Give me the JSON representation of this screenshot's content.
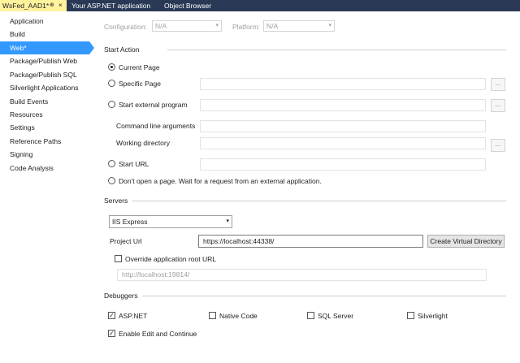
{
  "tabs": {
    "active": "WsFed_AAD1*",
    "pin_glyph": "⊕",
    "close_glyph": "×",
    "others": [
      "Your ASP.NET application",
      "Object Browser"
    ]
  },
  "sidebar": {
    "items": [
      {
        "label": "Application"
      },
      {
        "label": "Build"
      },
      {
        "label": "Web*"
      },
      {
        "label": "Package/Publish Web"
      },
      {
        "label": "Package/Publish SQL"
      },
      {
        "label": "Silverlight Applications"
      },
      {
        "label": "Build Events"
      },
      {
        "label": "Resources"
      },
      {
        "label": "Settings"
      },
      {
        "label": "Reference Paths"
      },
      {
        "label": "Signing"
      },
      {
        "label": "Code Analysis"
      }
    ],
    "selected_index": 2
  },
  "config": {
    "configuration_label": "Configuration:",
    "configuration_value": "N/A",
    "platform_label": "Platform:",
    "platform_value": "N/A"
  },
  "start_action": {
    "title": "Start Action",
    "current_page": "Current Page",
    "specific_page": "Specific Page",
    "external_program": "Start external program",
    "command_line_args": "Command line arguments",
    "working_directory": "Working directory",
    "start_url": "Start URL",
    "dont_open": "Don't open a page.  Wait for a request from an external application.",
    "browse_label": "..."
  },
  "servers": {
    "title": "Servers",
    "server_value": "IIS Express",
    "project_url_label": "Project Url",
    "project_url_value": "https://localhost:44338/",
    "create_vdir_button": "Create Virtual Directory",
    "override_label": "Override application root URL",
    "override_value": "http://localhost:19814/"
  },
  "debuggers": {
    "title": "Debuggers",
    "aspnet": "ASP.NET",
    "native": "Native Code",
    "sql": "SQL Server",
    "silverlight": "Silverlight",
    "edit_continue": "Enable Edit and Continue"
  },
  "glyphs": {
    "check": "✓",
    "dropdown": "▾"
  }
}
